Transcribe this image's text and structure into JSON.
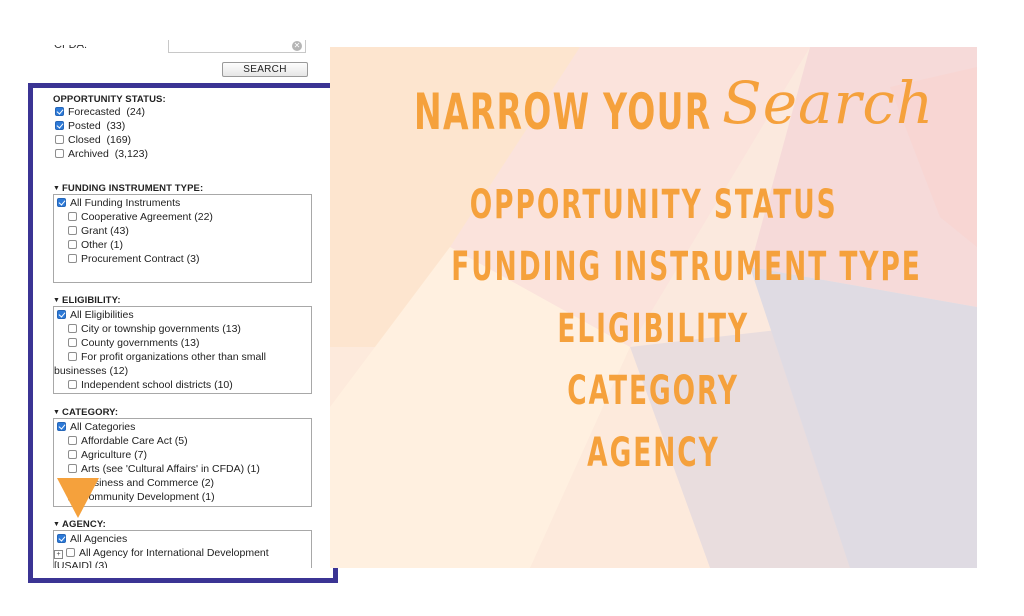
{
  "search": {
    "cfda_label": "CFDA:",
    "cfda_value": "",
    "button_label": "SEARCH"
  },
  "opportunity_status": {
    "title": "OPPORTUNITY STATUS:",
    "items": [
      {
        "label": "Forecasted",
        "count": "(24)",
        "checked": true
      },
      {
        "label": "Posted",
        "count": "(33)",
        "checked": true
      },
      {
        "label": "Closed",
        "count": "(169)",
        "checked": false
      },
      {
        "label": "Archived",
        "count": "(3,123)",
        "checked": false
      }
    ]
  },
  "funding_instrument": {
    "title": "FUNDING INSTRUMENT TYPE:",
    "all_label": "All Funding Instruments",
    "items": [
      {
        "label": "Cooperative Agreement (22)"
      },
      {
        "label": "Grant (43)"
      },
      {
        "label": "Other (1)"
      },
      {
        "label": "Procurement Contract (3)"
      }
    ]
  },
  "eligibility": {
    "title": "ELIGIBILITY:",
    "all_label": "All Eligibilities",
    "items": [
      {
        "label": "City or township governments (13)"
      },
      {
        "label": "County governments (13)"
      },
      {
        "label": "For profit organizations other than small",
        "label_cont": "businesses (12)"
      },
      {
        "label": "Independent school districts (10)"
      }
    ]
  },
  "category": {
    "title": "CATEGORY:",
    "all_label": "All Categories",
    "items": [
      {
        "label": "Affordable Care Act (5)"
      },
      {
        "label": "Agriculture (7)"
      },
      {
        "label": "Arts (see 'Cultural Affairs' in CFDA) (1)"
      },
      {
        "label": "Business and Commerce (2)"
      },
      {
        "label": "Community Development (1)"
      }
    ]
  },
  "agency": {
    "title": "AGENCY:",
    "all_label": "All Agencies",
    "items": [
      {
        "label": "All Agency for International Development",
        "label_cont": "[USAID] (3)"
      }
    ]
  },
  "slide": {
    "headline_main": "NARROW YOUR",
    "headline_script": "Search",
    "topics": [
      "OPPORTUNITY STATUS",
      "FUNDING INSTRUMENT TYPE",
      "ELIGIBILITY",
      "CATEGORY",
      "AGENCY"
    ],
    "accent_color": "#f5a13c",
    "frame_color": "#3b3494"
  }
}
